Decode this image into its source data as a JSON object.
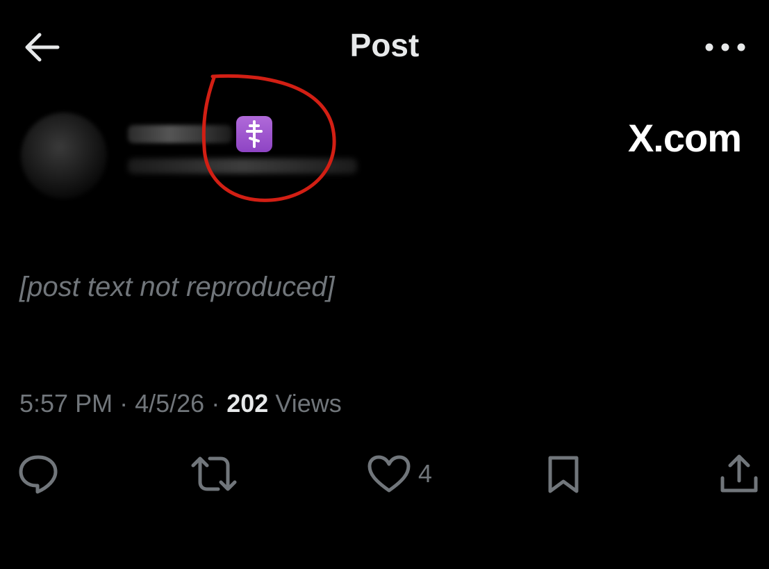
{
  "header": {
    "title": "Post",
    "back_icon": "arrow-left-icon",
    "more_icon": "more-horizontal-icon"
  },
  "author": {
    "badge_icon": "orthodox-cross-emoji"
  },
  "watermark": "X.com",
  "tweet": {
    "time": "5:57 PM",
    "date": "4/5/26",
    "separator": "·",
    "views_count": "202",
    "views_label": "Views"
  },
  "actions": {
    "reply_icon": "reply-icon",
    "repost_icon": "repost-icon",
    "like_icon": "heart-icon",
    "like_count": "4",
    "bookmark_icon": "bookmark-icon",
    "share_icon": "share-icon"
  },
  "colors": {
    "background": "#000000",
    "primary_text": "#e7e9ea",
    "secondary_text": "#71767b",
    "annotation": "#d21f14",
    "emoji_purple": "#9b4fd0"
  }
}
